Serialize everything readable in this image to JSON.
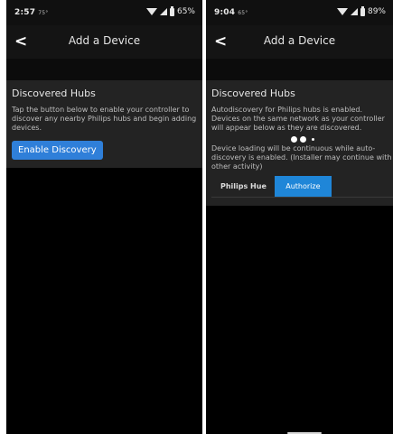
{
  "left": {
    "status": {
      "time": "2:57",
      "temp": "75°",
      "battery": "65%"
    },
    "header": {
      "back_glyph": "<",
      "title": "Add a Device"
    },
    "card": {
      "title": "Discovered Hubs",
      "text": "Tap the button below to enable your controller to discover any nearby Philips hubs and begin adding devices.",
      "button": "Enable Discovery"
    }
  },
  "right": {
    "status": {
      "time": "9:04",
      "temp": "65°",
      "battery": "89%"
    },
    "header": {
      "back_glyph": "<",
      "title": "Add a Device"
    },
    "card": {
      "title": "Discovered Hubs",
      "text": "Autodiscovery for Philips hubs is enabled. Devices on the same network as your controller will appear below as they are discovered.",
      "loading_text": "Device loading will be continuous while auto-discovery is enabled. (Installer may continue with other activity)",
      "hub_name": "Philips Hue",
      "authorize_button": "Authorize"
    }
  },
  "icons": [
    "wifi-icon",
    "signal-icon",
    "battery-icon",
    "back-chevron-icon",
    "loading-dots-icon"
  ],
  "colors": {
    "accent": "#2f7fd9",
    "card": "#232323",
    "background": "#000000"
  }
}
